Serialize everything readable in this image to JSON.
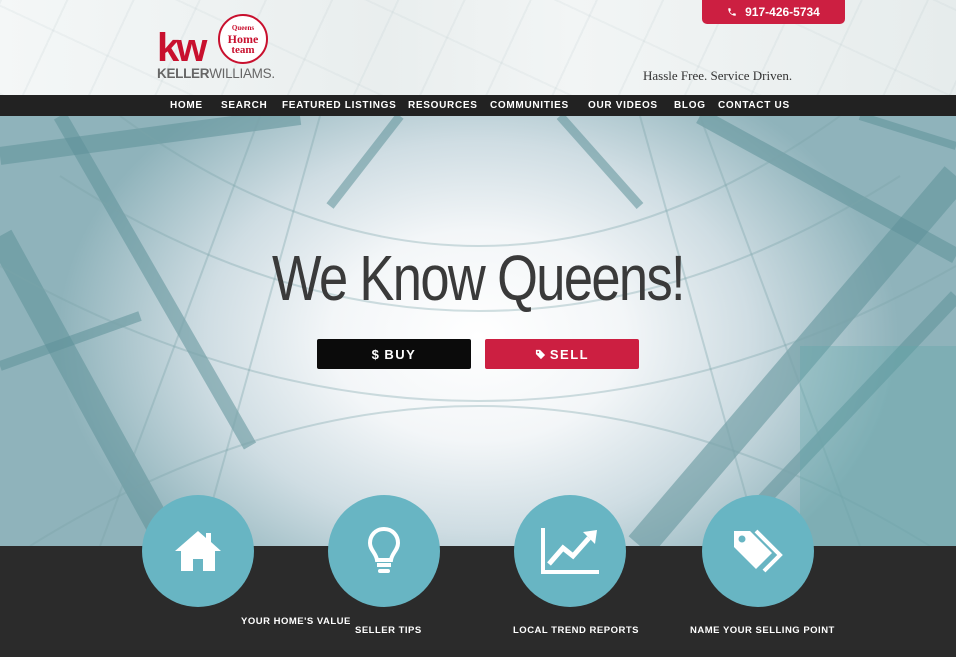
{
  "header": {
    "logo_kw": "kw",
    "logo_name_bold": "KELLER",
    "logo_name_rest": "WILLIAMS.",
    "badge_line1": "Queens",
    "badge_line2": "Home",
    "badge_line3": "team",
    "phone": "917-426-5734",
    "tagline": "Hassle Free. Service Driven."
  },
  "nav": {
    "items": [
      "HOME",
      "SEARCH",
      "FEATURED LISTINGS",
      "RESOURCES",
      "COMMUNITIES",
      "OUR VIDEOS",
      "BLOG",
      "CONTACT US"
    ]
  },
  "hero": {
    "title": "We Know Queens!",
    "buy_label": "BUY",
    "sell_label": "SELL",
    "buy_icon": "dollar-icon",
    "sell_icon": "tag-icon"
  },
  "features": [
    {
      "label": "YOUR HOME'S VALUE",
      "icon": "home-icon"
    },
    {
      "label": "SELLER TIPS",
      "icon": "lightbulb-icon"
    },
    {
      "label": "LOCAL TREND REPORTS",
      "icon": "trend-chart-icon"
    },
    {
      "label": "NAME YOUR SELLING POINT",
      "icon": "tags-icon"
    }
  ],
  "colors": {
    "brand_red": "#cc1f41",
    "teal": "#68b5c3",
    "dark": "#2b2b2b",
    "nav": "#222222"
  }
}
